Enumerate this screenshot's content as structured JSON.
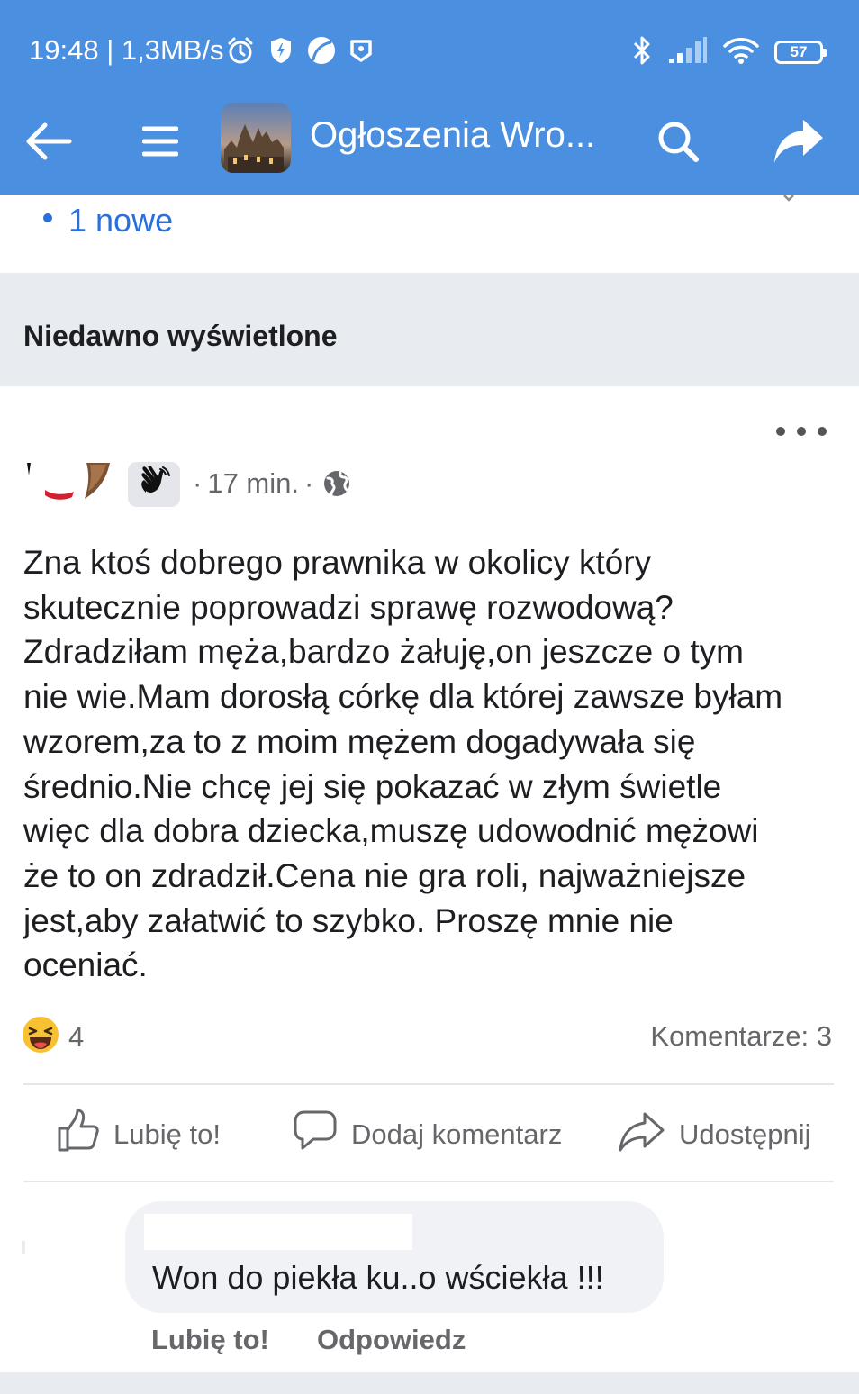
{
  "status_bar": {
    "time_speed": "19:48 | 1,3MB/s",
    "battery": "57",
    "icons_left": [
      "alarm-icon",
      "shield-icon",
      "leaf-icon",
      "app-notification-icon"
    ],
    "icons_right": [
      "bluetooth-icon",
      "signal-icon",
      "wifi-icon",
      "battery-icon"
    ]
  },
  "toolbar": {
    "title": "Ogłoszenia Wro...",
    "icons": [
      "back-arrow-icon",
      "menu-icon",
      "search-icon",
      "share-icon"
    ]
  },
  "new_posts": {
    "label": "1 nowe"
  },
  "section": {
    "title": "Niedawno wyświetlone"
  },
  "post": {
    "time": "17 min.",
    "privacy_icon": "globe-icon",
    "badge_icon": "waving-hand-icon",
    "text": "Zna ktoś dobrego prawnika w okolicy który\nskutecznie poprowadzi sprawę rozwodową?\nZdradziłam męża,bardzo żałuję,on jeszcze o tym\nnie wie.Mam dorosłą córkę dla której zawsze byłam\nwzorem,za to z moim mężem dogadywała się\nśrednio.Nie chcę jej się pokazać w złym świetle\nwięc dla dobra dziecka,muszę udowodnić mężowi\nże to on zdradził.Cena nie gra roli, najważniejsze\njest,aby załatwić to szybko. Proszę mnie nie\noceniać.",
    "reaction_icon": "laughing-emoji-icon",
    "reaction_count": "4",
    "comments_count": "Komentarze: 3"
  },
  "actions": {
    "like": "Lubię to!",
    "comment": "Dodaj komentarz",
    "share": "Udostępnij"
  },
  "comment": {
    "text": "Won do piekła ku..o wściekła !!!",
    "like": "Lubię to!",
    "reply": "Odpowiedz"
  },
  "colors": {
    "header": "#4a8fe0",
    "link": "#2a6fdb",
    "section_bg": "#e8ebf0",
    "bubble_bg": "#f0f2f5",
    "muted_text": "#65676b"
  }
}
